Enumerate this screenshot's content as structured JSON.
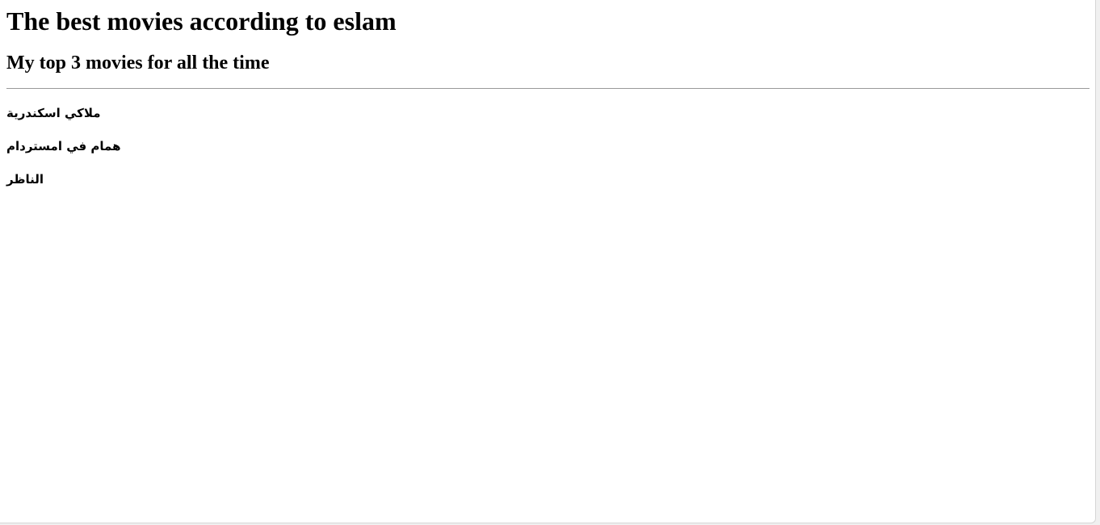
{
  "page": {
    "title": "The best movies according to eslam",
    "subtitle": "My top 3 movies for all the time"
  },
  "movies": [
    {
      "label": "ملاكي اسكندرية"
    },
    {
      "label": "همام في امستردام"
    },
    {
      "label": "الناظر"
    }
  ]
}
